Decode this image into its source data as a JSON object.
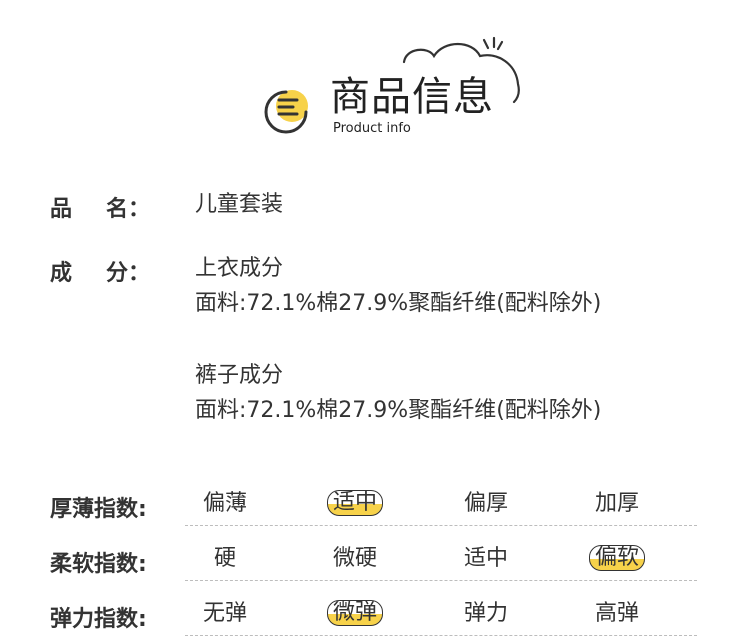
{
  "header": {
    "title": "商品信息",
    "subtitle": "Product info",
    "icons": [
      "document-icon",
      "cloud-icon",
      "sparkle-icon"
    ],
    "accent_color": "#f7d24a"
  },
  "info": {
    "name_label": "品　名：",
    "name_label_chars": [
      "品",
      "名："
    ],
    "name_value": "儿童套装",
    "composition_label_chars": [
      "成",
      "分："
    ],
    "top_title": "上衣成分",
    "top_detail": "面料:72.1%棉27.9%聚酯纤维(配料除外)",
    "pants_title": "裤子成分",
    "pants_detail": "面料:72.1%棉27.9%聚酯纤维(配料除外)"
  },
  "indices": [
    {
      "label": "厚薄指数:",
      "options": [
        "偏薄",
        "适中",
        "偏厚",
        "加厚"
      ],
      "selected": "适中"
    },
    {
      "label": "柔软指数:",
      "options": [
        "硬",
        "微硬",
        "适中",
        "偏软"
      ],
      "selected": "偏软"
    },
    {
      "label": "弹力指数:",
      "options": [
        "无弹",
        "微弹",
        "弹力",
        "高弹"
      ],
      "selected": "微弹"
    }
  ]
}
